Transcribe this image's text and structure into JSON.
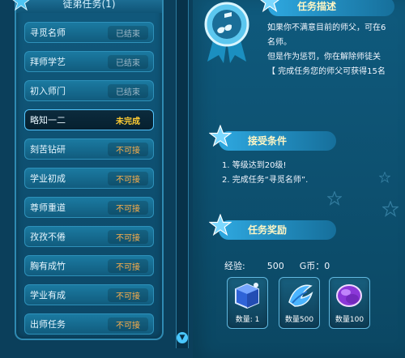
{
  "left": {
    "header_title": "徒弟任务(1)",
    "tasks": [
      {
        "name": "寻觅名师",
        "status": "已结束"
      },
      {
        "name": "拜师学艺",
        "status": "已结束"
      },
      {
        "name": "初入师门",
        "status": "已结束"
      },
      {
        "name": "略知一二",
        "status": "未完成"
      },
      {
        "name": "刻苦钻研",
        "status": "不可接"
      },
      {
        "name": "学业初成",
        "status": "不可接"
      },
      {
        "name": "尊师重道",
        "status": "不可接"
      },
      {
        "name": "孜孜不倦",
        "status": "不可接"
      },
      {
        "name": "胸有成竹",
        "status": "不可接"
      },
      {
        "name": "学业有成",
        "status": "不可接"
      },
      {
        "name": "出师任务",
        "status": "不可接"
      }
    ]
  },
  "right": {
    "desc_title": "任务描述",
    "desc_lines": [
      "如果你不满意目前的师父，可在6",
      "名师。",
      "但是作为惩罚，你在解除师徒关",
      "【 完成任务您的师父可获得15名"
    ],
    "cond_title": "接受条件",
    "cond_lines": [
      "1. 等级达到20级!",
      "2. 完成任务“寻觅名师”."
    ],
    "reward_title": "任务奖励",
    "reward_exp_label": "经验:",
    "reward_exp_value": "500",
    "reward_gold_label": "G币：0",
    "rewards": [
      {
        "label": "数量: 1"
      },
      {
        "label": "数量500"
      },
      {
        "label": "数量100"
      }
    ]
  },
  "colors": {
    "accent": "#2ea8e0",
    "gold": "#ffcc33",
    "status_orange": "#ffb04a",
    "status_gray": "#9cb7c7"
  }
}
